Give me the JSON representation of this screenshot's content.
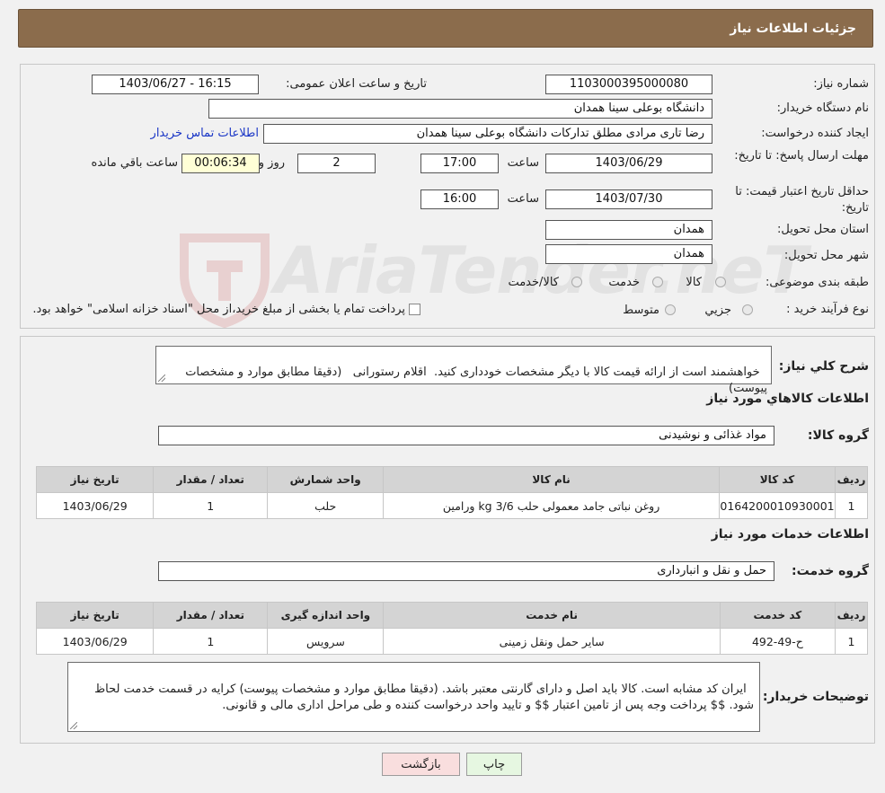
{
  "header": {
    "title": "جزئیات اطلاعات نیاز"
  },
  "form": {
    "need_number_label": "شماره نیاز:",
    "need_number": "1103000395000080",
    "announce_label": "تاریخ و ساعت اعلان عمومی:",
    "announce_value": "1403/06/27 - 16:15",
    "buyer_org_label": "نام دستگاه خریدار:",
    "buyer_org": "دانشگاه بوعلی سینا همدان",
    "creator_label": "ایجاد کننده درخواست:",
    "creator": "رضا تاری مرادی مطلق تدارکات دانشگاه بوعلی سینا همدان",
    "contact_link": "اطلاعات تماس خریدار",
    "deadline_label": "مهلت ارسال پاسخ: تا تاریخ:",
    "deadline_date": "1403/06/29",
    "time_label": "ساعت",
    "deadline_time": "17:00",
    "days_value": "2",
    "days_label": "روز و",
    "remaining_time": "00:06:34",
    "remaining_label": "ساعت باقي مانده",
    "validity_label": "حداقل تاریخ اعتبار قیمت: تا تاریخ:",
    "validity_date": "1403/07/30",
    "validity_time": "16:00",
    "province_label": "استان محل تحویل:",
    "province": "همدان",
    "city_label": "شهر محل تحویل:",
    "city": "همدان",
    "category_label": "طبقه بندی موضوعی:",
    "category_options": [
      "کالا",
      "خدمت",
      "کالا/خدمت"
    ],
    "process_label": "نوع فرآیند خرید :",
    "process_options": [
      "جزیي",
      "متوسط"
    ],
    "process_note": "پرداخت تمام یا بخشی از مبلغ خرید،از محل \"اسناد خزانه اسلامی\" خواهد بود."
  },
  "description": {
    "label": "شرح کلي نیاز:",
    "text": "خواهشمند است از ارائه قیمت کالا با دیگر مشخصات خودداری کنید.  اقلام رستورانی   (دقیقا مطابق موارد و مشخصات پیوست)"
  },
  "goods": {
    "section_title": "اطلاعات کالاهاي مورد نياز",
    "group_label": "گروه کالا:",
    "group_value": "مواد غذائی و نوشیدنی",
    "columns": [
      "ردیف",
      "کد کالا",
      "نام کالا",
      "واحد شمارش",
      "تعداد / مقدار",
      "تاریخ نیاز"
    ],
    "rows": [
      [
        "1",
        "0164200010930001",
        "روغن نباتی جامد معمولی حلب 3/6 kg ورامین",
        "حلب",
        "1",
        "1403/06/29"
      ]
    ]
  },
  "services": {
    "section_title": "اطلاعات خدمات مورد نياز",
    "group_label": "گروه خدمت:",
    "group_value": "حمل و نقل و انبارداری",
    "columns": [
      "ردیف",
      "کد خدمت",
      "نام خدمت",
      "واحد اندازه گیری",
      "تعداد / مقدار",
      "تاریخ نیاز"
    ],
    "rows": [
      [
        "1",
        "ح-49-492",
        "سایر حمل ونقل زمینی",
        "سرویس",
        "1",
        "1403/06/29"
      ]
    ]
  },
  "buyer_notes": {
    "label": "توضیحات خریدار:",
    "text": "ایران کد مشابه است. کالا باید اصل و دارای گارنتی معتبر باشد. (دقیقا مطابق موارد و مشخصات پیوست) کرایه در قسمت خدمت لحاظ شود. $$ پرداخت وجه پس از تامین اعتبار $$ و تایید واحد درخواست کننده و طی مراحل اداری مالی و قانونی."
  },
  "buttons": {
    "print": "چاپ",
    "back": "بازگشت"
  },
  "watermark": "AriaTender.neT",
  "colors": {
    "header_bg": "#8b6c4c",
    "link": "#1a36c6",
    "back_btn": "#f9dede",
    "print_btn": "#e6f7e1"
  }
}
